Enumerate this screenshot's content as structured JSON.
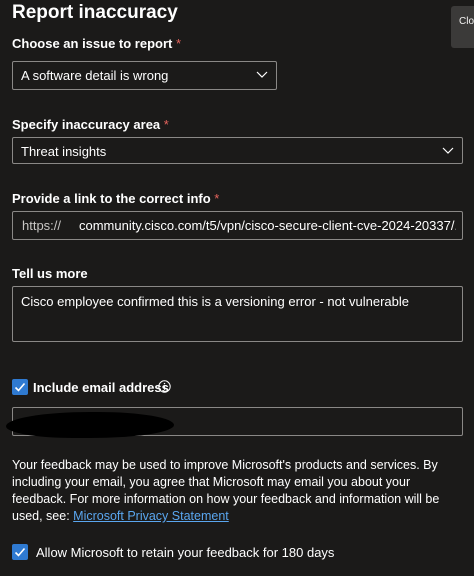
{
  "title": "Report inaccuracy",
  "side_tab": {
    "label": "Clo"
  },
  "issue": {
    "label": "Choose an issue to report",
    "required_mark": "*",
    "selected": "A software detail is wrong"
  },
  "area": {
    "label": "Specify inaccuracy area",
    "required_mark": "*",
    "selected": "Threat insights"
  },
  "link": {
    "label": "Provide a link to the correct info",
    "required_mark": "*",
    "prefix": "https://",
    "value": "community.cisco.com/t5/vpn/cisco-secure-client-cve-2024-20337/..."
  },
  "tell_more": {
    "label": "Tell us more",
    "value": "Cisco employee confirmed this is a versioning error - not vulnerable"
  },
  "email": {
    "checkbox_label": "Include email address",
    "checked": true,
    "info_icon": "info-icon"
  },
  "disclaimer": {
    "text": "Your feedback may be used to improve Microsoft's products and services. By including your email, you agree that Microsoft may email you about your feedback. For more information on how your feedback and information will be used, see: ",
    "link_text": "Microsoft Privacy Statement"
  },
  "retain": {
    "checkbox_label": "Allow Microsoft to retain your feedback for 180 days",
    "checked": true
  },
  "colors": {
    "background": "#1b1a19",
    "accent": "#2f7ad1",
    "link": "#5aa6ef",
    "required": "#e8655e",
    "border": "#8a8886"
  }
}
